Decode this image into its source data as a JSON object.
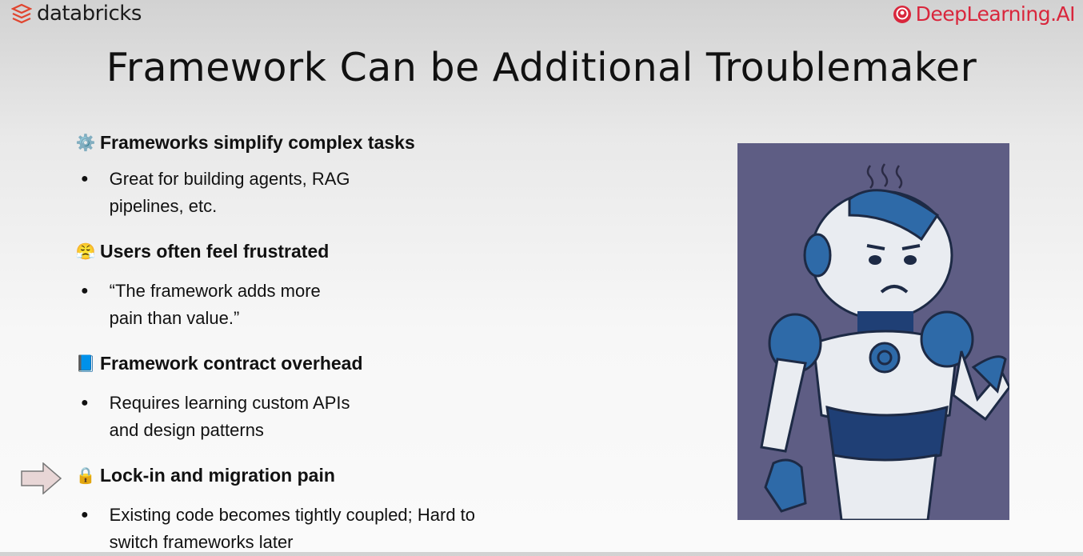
{
  "header": {
    "left_logo": "databricks",
    "right_logo": "DeepLearning.AI"
  },
  "title": "Framework Can be Additional Troublemaker",
  "sections": [
    {
      "icon": "gear-icon",
      "emoji": "⚙️",
      "heading": "Frameworks simplify complex tasks",
      "bullet": "Great for building agents, RAG pipelines, etc."
    },
    {
      "icon": "frustrated-face-icon",
      "emoji": "😤",
      "heading": "Users often feel frustrated",
      "bullet": "“The framework adds more pain than value.”"
    },
    {
      "icon": "book-icon",
      "emoji": "📘",
      "heading": "Framework contract overhead",
      "bullet": "Requires learning custom APIs and design patterns"
    },
    {
      "icon": "lock-icon",
      "emoji": "🔒",
      "heading": "Lock-in and migration pain",
      "bullet": "Existing code becomes tightly coupled; Hard to switch frameworks later"
    }
  ],
  "colors": {
    "brand_red": "#d9263c",
    "robot_bg": "#5e5d84",
    "robot_blue": "#2e6aa8"
  }
}
